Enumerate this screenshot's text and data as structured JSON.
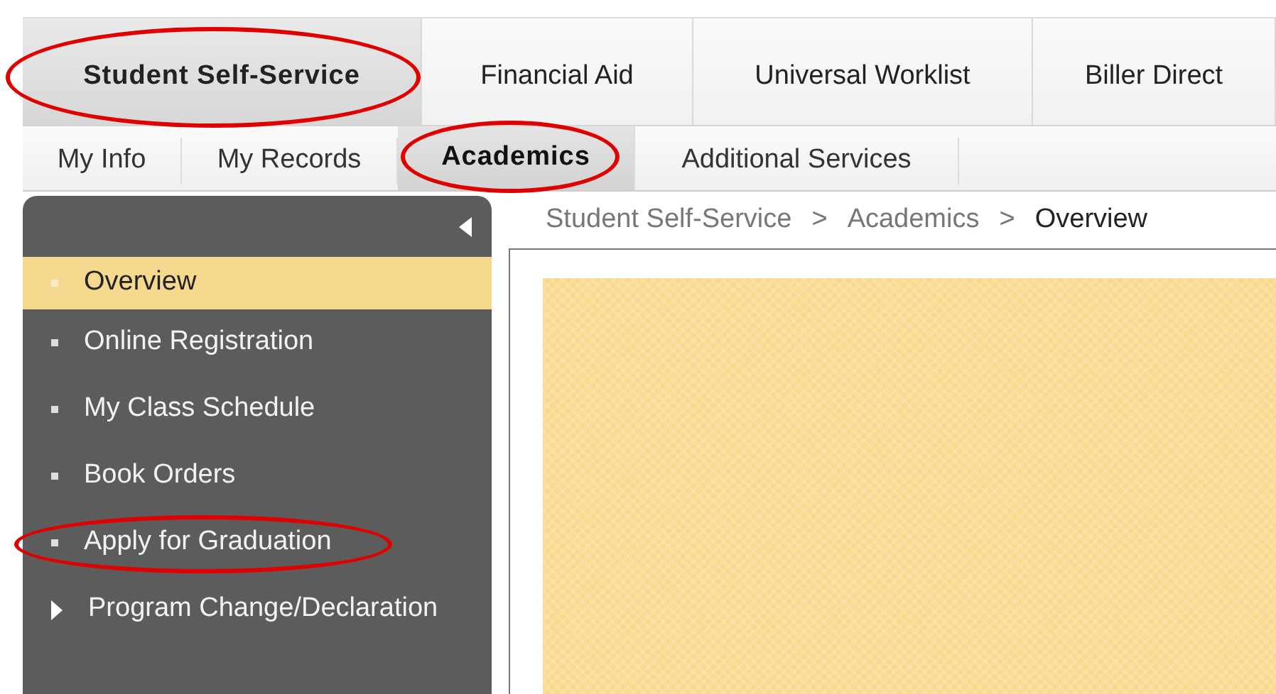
{
  "top_tabs": [
    {
      "label": "Student Self-Service",
      "selected": true,
      "circled": true
    },
    {
      "label": "Financial Aid",
      "selected": false,
      "circled": false
    },
    {
      "label": "Universal Worklist",
      "selected": false,
      "circled": false
    },
    {
      "label": "Biller Direct",
      "selected": false,
      "circled": false
    }
  ],
  "sub_tabs": [
    {
      "label": "My Info",
      "selected": false,
      "circled": false
    },
    {
      "label": "My Records",
      "selected": false,
      "circled": false
    },
    {
      "label": "Academics",
      "selected": true,
      "circled": true
    },
    {
      "label": "Additional Services",
      "selected": false,
      "circled": false
    }
  ],
  "sidebar": {
    "items": [
      {
        "label": "Overview",
        "kind": "leaf",
        "selected": true,
        "circled": false
      },
      {
        "label": "Online Registration",
        "kind": "leaf",
        "selected": false,
        "circled": false
      },
      {
        "label": "My Class Schedule",
        "kind": "leaf",
        "selected": false,
        "circled": false
      },
      {
        "label": "Book Orders",
        "kind": "leaf",
        "selected": false,
        "circled": false
      },
      {
        "label": "Apply for Graduation",
        "kind": "leaf",
        "selected": false,
        "circled": true
      },
      {
        "label": "Program Change/Declaration",
        "kind": "folder",
        "selected": false,
        "circled": false
      }
    ]
  },
  "breadcrumb": [
    {
      "kind": "link",
      "text": "Student Self-Service"
    },
    {
      "kind": "separator",
      "text": ">"
    },
    {
      "kind": "link",
      "text": "Academics"
    },
    {
      "kind": "separator",
      "text": ">"
    },
    {
      "kind": "current",
      "text": "Overview"
    }
  ]
}
